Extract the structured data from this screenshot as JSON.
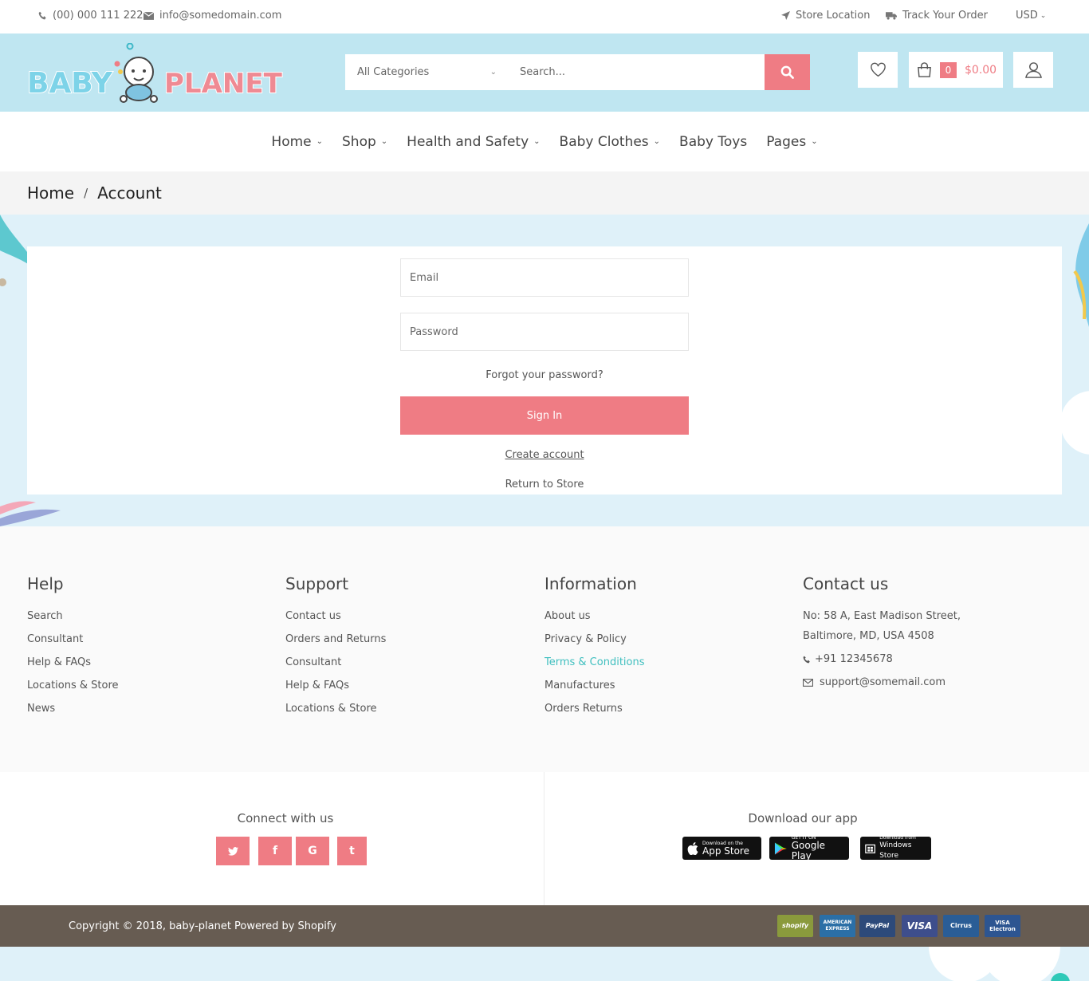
{
  "topbar": {
    "phone": "(00) 000 111 222",
    "email": "info@somedomain.com",
    "store_location": "Store Location",
    "track_order": "Track Your Order",
    "currency": "USD"
  },
  "header": {
    "logo_word1": "BABY",
    "logo_word2": "PLANET",
    "category_select": "All Categories",
    "search_placeholder": "Search...",
    "cart_count": "0",
    "cart_total": "$0.00"
  },
  "nav": {
    "items": [
      {
        "label": "Home"
      },
      {
        "label": "Shop"
      },
      {
        "label": "Health and Safety"
      },
      {
        "label": "Baby Clothes"
      },
      {
        "label": "Baby Toys"
      },
      {
        "label": "Pages"
      }
    ]
  },
  "breadcrumb": {
    "home": "Home",
    "separator": "/",
    "current": "Account"
  },
  "login": {
    "email_placeholder": "Email",
    "password_placeholder": "Password",
    "forgot": "Forgot your password?",
    "signin": "Sign In",
    "create_account": "Create account",
    "return_store": "Return to Store"
  },
  "footer": {
    "help": {
      "title": "Help",
      "links": [
        "Search",
        "Consultant",
        "Help & FAQs",
        "Locations & Store",
        "News"
      ]
    },
    "support": {
      "title": "Support",
      "links": [
        "Contact us",
        "Orders and Returns",
        "Consultant",
        "Help & FAQs",
        "Locations & Store"
      ]
    },
    "information": {
      "title": "Information",
      "links": [
        "About us",
        "Privacy & Policy",
        "Terms & Conditions",
        "Manufactures",
        "Orders Returns"
      ]
    },
    "contact": {
      "title": "Contact us",
      "address_line1": "No: 58 A, East Madison Street,",
      "address_line2": "Baltimore, MD, USA 4508",
      "phone": "+91 12345678",
      "email": "support@somemail.com"
    },
    "connect_title": "Connect with us",
    "social": [
      "t",
      "f",
      "G",
      "t"
    ],
    "app_title": "Download our app",
    "apps": [
      {
        "small": "Download on the",
        "big": "App Store"
      },
      {
        "small": "GET IT ON",
        "big": "Google Play"
      },
      {
        "small": "Download from",
        "big": "Windows Store"
      }
    ],
    "copyright": "Copyright © 2018, baby-planet Powered by Shopify",
    "payments": [
      {
        "label": "shopify",
        "color": "#8a9a3c"
      },
      {
        "label": "AMERICAN EXPRESS",
        "color": "#2b6fa6"
      },
      {
        "label": "PayPal",
        "color": "#2d4a7a"
      },
      {
        "label": "VISA",
        "color": "#3e4e8c"
      },
      {
        "label": "Cirrus",
        "color": "#2a5d96"
      },
      {
        "label": "VISA Electron",
        "color": "#2d5591"
      }
    ]
  },
  "colors": {
    "accent": "#ef7c84",
    "header_bg": "#bfe6f1",
    "teal_link": "#3fbfbf",
    "copyright_bg": "#675c52"
  }
}
